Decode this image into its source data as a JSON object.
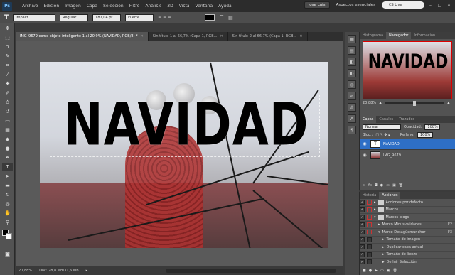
{
  "menubar": {
    "logo": "Ps",
    "items": [
      "Archivo",
      "Edición",
      "Imagen",
      "Capa",
      "Selección",
      "Filtro",
      "Análisis",
      "3D",
      "Vista",
      "Ventana",
      "Ayuda"
    ],
    "user": "Jose Luis",
    "workspace": "Aspectos esenciales",
    "cs_live": "CS Live"
  },
  "options": {
    "tool_glyph": "T",
    "font_family": "Impact",
    "font_style": "Regular",
    "font_size": "187,04 pt",
    "antialias": "Fuerte",
    "text_color": "#000000"
  },
  "tabs": [
    {
      "label": "IMG_9679 como objeto inteligente-1 al 20,9% (NAVIDAD, RGB/8) *",
      "active": true
    },
    {
      "label": "Sin título-1 al 66,7% (Capa 1, RGB...",
      "active": false
    },
    {
      "label": "Sin título-2 al 66,7% (Capa 1, RGB...",
      "active": false
    }
  ],
  "canvas": {
    "text": "NAVIDAD"
  },
  "status": {
    "zoom": "20,88%",
    "doc": "Doc: 28,8 MB/31,6 MB"
  },
  "navigator": {
    "tabs": [
      "Histograma",
      "Navegador",
      "Información"
    ],
    "active_tab": 1,
    "thumb_text": "NAVIDAD",
    "zoom": "20,88%"
  },
  "layers": {
    "tabs": [
      "Capas",
      "Canales",
      "Trazados"
    ],
    "blend_mode": "Normal",
    "opacity_label": "Opacidad:",
    "opacity": "100%",
    "lock_label": "Bloq.:",
    "fill_label": "Relleno:",
    "fill": "100%",
    "items": [
      {
        "name": "NAVIDAD",
        "thumb": "T",
        "selected": true
      },
      {
        "name": "IMG_9679",
        "thumb": "",
        "selected": false
      }
    ]
  },
  "actions": {
    "tabs": [
      "Historia",
      "Acciones"
    ],
    "active_tab": 1,
    "items": [
      {
        "label": "Acciones por defecto",
        "type": "folder",
        "indent": 0,
        "key": ""
      },
      {
        "label": "Marcos",
        "type": "folder",
        "indent": 0,
        "key": ""
      },
      {
        "label": "Marcos blogs",
        "type": "folder",
        "indent": 0,
        "key": ""
      },
      {
        "label": "Marco Minusvalidades",
        "type": "action",
        "indent": 1,
        "key": "F2"
      },
      {
        "label": "Marco Desagüemunchor",
        "type": "action",
        "indent": 1,
        "key": "F3"
      },
      {
        "label": "Tamaño de imagen",
        "type": "step",
        "indent": 2,
        "key": ""
      },
      {
        "label": "Duplicar capa actual",
        "type": "step",
        "indent": 2,
        "key": ""
      },
      {
        "label": "Tamaño de lienzo",
        "type": "step",
        "indent": 2,
        "key": ""
      },
      {
        "label": "Definir Selección",
        "type": "step",
        "indent": 2,
        "key": ""
      }
    ]
  }
}
